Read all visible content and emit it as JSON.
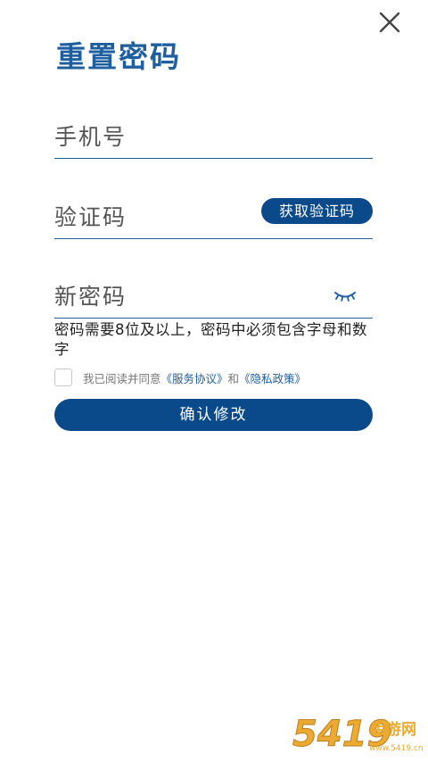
{
  "page": {
    "title": "重置密码",
    "close_icon": "close-icon"
  },
  "form": {
    "phone_placeholder": "手机号",
    "code_placeholder": "验证码",
    "get_code_label": "获取验证码",
    "password_placeholder": "新密码",
    "password_toggle_icon": "eye-closed-icon",
    "password_hint": "密码需要8位及以上，密码中必须包含字母和数字"
  },
  "agreement": {
    "prefix": "我已阅读并同意",
    "service_link": "《服务协议》",
    "conjunction": "和",
    "privacy_link": "《隐私政策》",
    "checked": false
  },
  "submit_label": "确认修改",
  "watermark": {
    "brand_text": "5419",
    "cn_text": "手游网",
    "domain_text": "www.5419.cn"
  },
  "colors": {
    "accent": "#0b4a8a",
    "title": "#1f5fa0",
    "watermark": "#e8a21a"
  }
}
